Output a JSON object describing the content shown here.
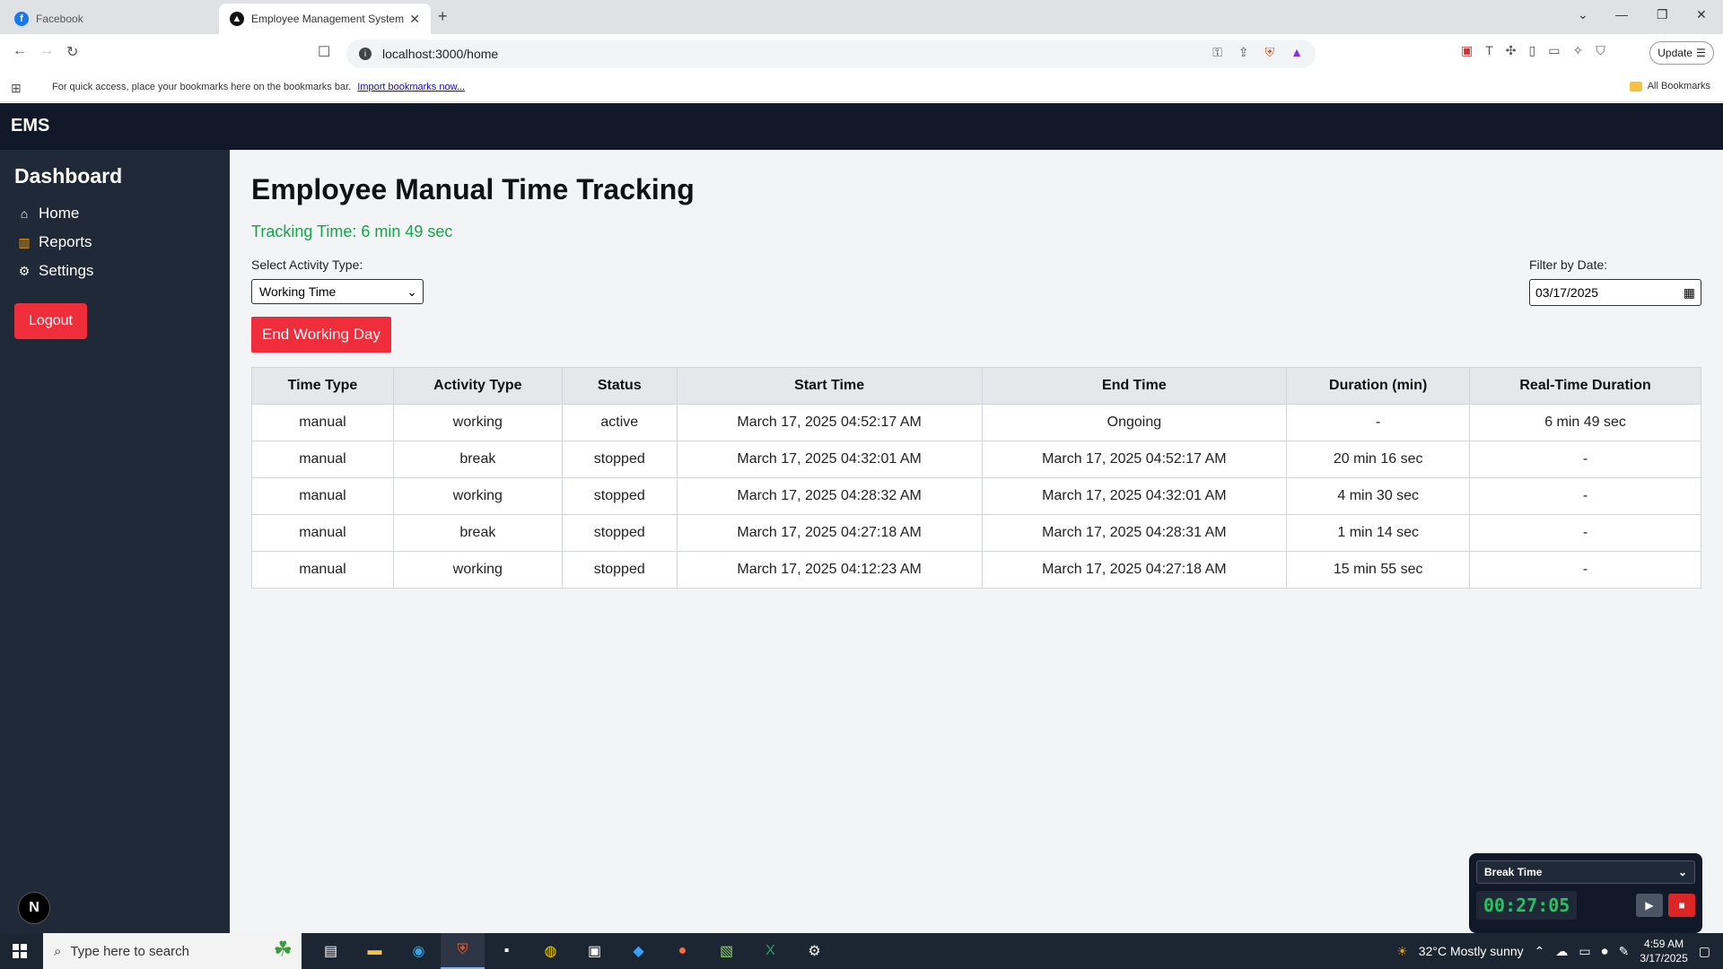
{
  "browser": {
    "tabs": [
      {
        "title": "Facebook",
        "active": false
      },
      {
        "title": "Employee Management System",
        "active": true
      }
    ],
    "url": "localhost:3000/home",
    "update_label": "Update",
    "bookmarks_message": "For quick access, place your bookmarks here on the bookmarks bar.",
    "bookmarks_link": "Import bookmarks now...",
    "all_bookmarks": "All Bookmarks"
  },
  "app": {
    "brand": "EMS",
    "sidebar": {
      "title": "Dashboard",
      "items": [
        {
          "label": "Home",
          "icon": "home-icon"
        },
        {
          "label": "Reports",
          "icon": "bar-chart-icon"
        },
        {
          "label": "Settings",
          "icon": "gear-icon"
        }
      ],
      "logout_label": "Logout",
      "badge": "N"
    },
    "main": {
      "title": "Employee Manual Time Tracking",
      "tracking_text": "Tracking Time: 6 min 49 sec",
      "activity_label": "Select Activity Type:",
      "activity_value": "Working Time",
      "filter_label": "Filter by Date:",
      "filter_value": "03/17/2025",
      "end_day_label": "End Working Day",
      "table": {
        "headers": [
          "Time Type",
          "Activity Type",
          "Status",
          "Start Time",
          "End Time",
          "Duration (min)",
          "Real-Time Duration"
        ],
        "rows": [
          [
            "manual",
            "working",
            "active",
            "March 17, 2025 04:52:17 AM",
            "Ongoing",
            "-",
            "6 min 49 sec"
          ],
          [
            "manual",
            "break",
            "stopped",
            "March 17, 2025 04:32:01 AM",
            "March 17, 2025 04:52:17 AM",
            "20 min 16 sec",
            "-"
          ],
          [
            "manual",
            "working",
            "stopped",
            "March 17, 2025 04:28:32 AM",
            "March 17, 2025 04:32:01 AM",
            "4 min 30 sec",
            "-"
          ],
          [
            "manual",
            "break",
            "stopped",
            "March 17, 2025 04:27:18 AM",
            "March 17, 2025 04:28:31 AM",
            "1 min 14 sec",
            "-"
          ],
          [
            "manual",
            "working",
            "stopped",
            "March 17, 2025 04:12:23 AM",
            "March 17, 2025 04:27:18 AM",
            "15 min 55 sec",
            "-"
          ]
        ]
      }
    },
    "timer_widget": {
      "mode": "Break Time",
      "time": "00:27:05"
    }
  },
  "taskbar": {
    "search_placeholder": "Type here to search",
    "weather": "32°C  Mostly sunny",
    "time": "4:59 AM",
    "date": "3/17/2025"
  },
  "colors": {
    "accent_red": "#f02d3a",
    "tracking_green": "#16a34a",
    "header_bg": "#111827",
    "sidebar_bg": "#1f2937"
  }
}
